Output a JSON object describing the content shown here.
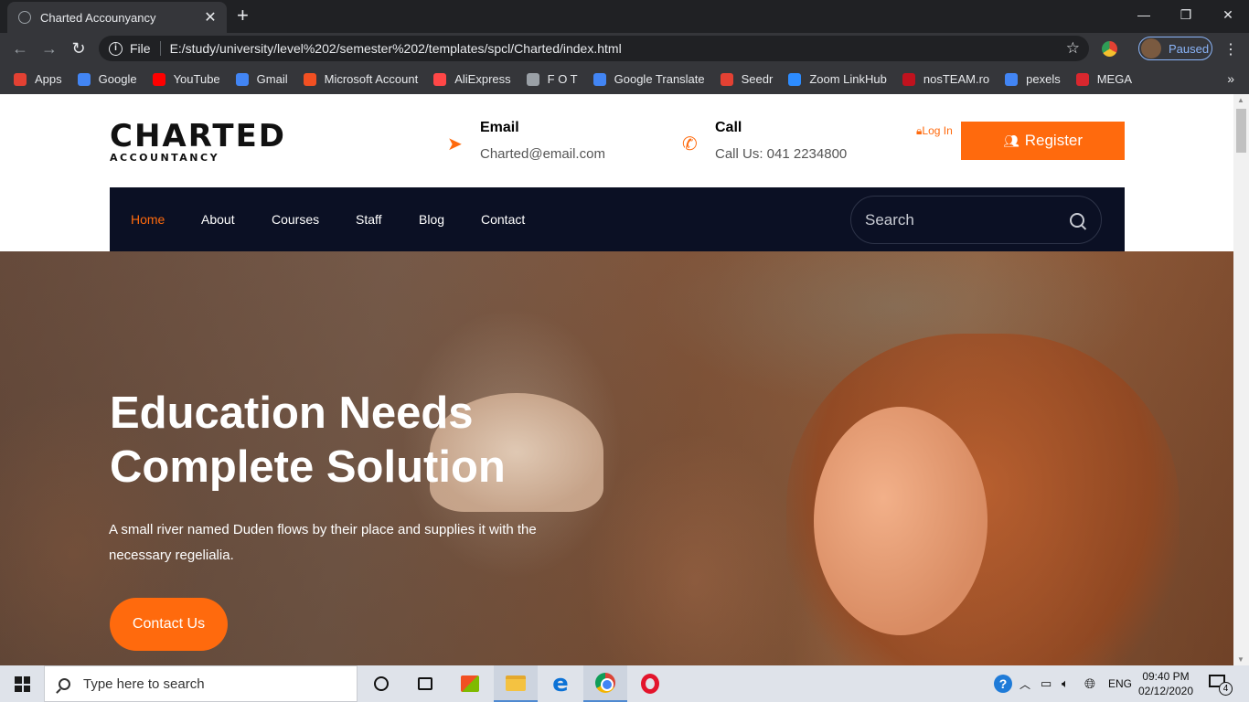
{
  "browser": {
    "tab_title": "Charted Accounyancy",
    "tab_close": "✕",
    "new_tab": "+",
    "window_controls": {
      "minimize": "—",
      "restore": "❐",
      "close": "✕"
    },
    "nav": {
      "back": "←",
      "forward": "→",
      "reload": "↻"
    },
    "address": {
      "info": "i",
      "scheme_label": "File",
      "url": "E:/study/university/level%202/semester%202/templates/spcl/Charted/index.html",
      "star": "☆"
    },
    "profile_label": "Paused",
    "menu": "⋮",
    "bookmarks": [
      {
        "label": "Apps",
        "icon": "apps-grid-icon",
        "color": "#e34133"
      },
      {
        "label": "Google",
        "icon": "google-icon",
        "color": "#4285f4"
      },
      {
        "label": "YouTube",
        "icon": "youtube-icon",
        "color": "#ff0000"
      },
      {
        "label": "Gmail",
        "icon": "google-icon",
        "color": "#4285f4"
      },
      {
        "label": "Microsoft Account",
        "icon": "microsoft-icon",
        "color": "#f25022"
      },
      {
        "label": "AliExpress",
        "icon": "aliexpress-icon",
        "color": "#ff4747"
      },
      {
        "label": "F O T",
        "icon": "fot-icon",
        "color": "#9aa0a6"
      },
      {
        "label": "Google Translate",
        "icon": "translate-icon",
        "color": "#4285f4"
      },
      {
        "label": "Seedr",
        "icon": "seedr-icon",
        "color": "#e34133"
      },
      {
        "label": "Zoom LinkHub",
        "icon": "zoom-linkhub-icon",
        "color": "#2d8cff"
      },
      {
        "label": "nosTEAM.ro",
        "icon": "nosteam-icon",
        "color": "#c0121e"
      },
      {
        "label": "pexels",
        "icon": "google-icon",
        "color": "#4285f4"
      },
      {
        "label": "MEGA",
        "icon": "mega-icon",
        "color": "#d9272e"
      }
    ],
    "bookmarks_more": "»"
  },
  "site": {
    "logo": {
      "main": "CHARTED",
      "sub": "ACCOUNTANCY"
    },
    "email": {
      "title": "Email",
      "value": "Charted@email.com",
      "icon": "paper-plane-icon"
    },
    "call": {
      "title": "Call",
      "value": "Call Us: 041 2234800",
      "icon": "phone-icon"
    },
    "login": "Log In",
    "register": "Register",
    "nav": [
      {
        "label": "Home",
        "active": true
      },
      {
        "label": "About",
        "active": false
      },
      {
        "label": "Courses",
        "active": false
      },
      {
        "label": "Staff",
        "active": false
      },
      {
        "label": "Blog",
        "active": false
      },
      {
        "label": "Contact",
        "active": false
      }
    ],
    "search_placeholder": "Search",
    "hero": {
      "title_line1": "Education Needs",
      "title_line2": "Complete Solution",
      "text": "A small river named Duden flows by their place and supplies it with the necessary regelialia.",
      "button": "Contact Us"
    },
    "colors": {
      "accent": "#ff6a0d",
      "navbar": "#0b1024"
    }
  },
  "taskbar": {
    "search_placeholder": "Type here to search",
    "tray": {
      "language": "ENG",
      "time": "09:40 PM",
      "date": "02/12/2020",
      "notifications": "4"
    }
  }
}
